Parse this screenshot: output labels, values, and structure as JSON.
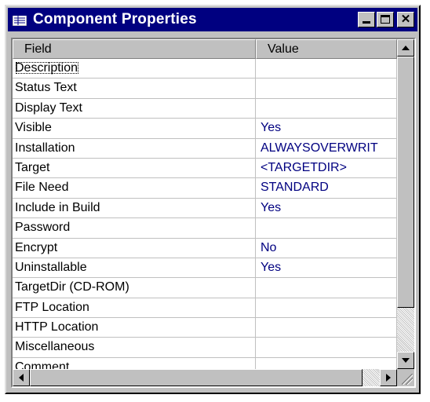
{
  "window": {
    "title": "Component Properties"
  },
  "icons": {
    "title": "properties-window-icon",
    "minimize": "minimize-icon",
    "maximize": "maximize-icon",
    "close": "close-icon",
    "close_glyph": "✕"
  },
  "grid": {
    "columns": [
      "Field",
      "Value"
    ],
    "rows": [
      {
        "field": "Description",
        "value": ""
      },
      {
        "field": "Status Text",
        "value": ""
      },
      {
        "field": "Display Text",
        "value": ""
      },
      {
        "field": "Visible",
        "value": "Yes"
      },
      {
        "field": "Installation",
        "value": "ALWAYSOVERWRIT"
      },
      {
        "field": "Target",
        "value": "<TARGETDIR>"
      },
      {
        "field": "File Need",
        "value": "STANDARD"
      },
      {
        "field": "Include in Build",
        "value": "Yes"
      },
      {
        "field": "Password",
        "value": ""
      },
      {
        "field": "Encrypt",
        "value": "No"
      },
      {
        "field": "Uninstallable",
        "value": "Yes"
      },
      {
        "field": "TargetDir (CD-ROM)",
        "value": ""
      },
      {
        "field": "FTP Location",
        "value": ""
      },
      {
        "field": "HTTP Location",
        "value": ""
      },
      {
        "field": "Miscellaneous",
        "value": ""
      },
      {
        "field": "Comment",
        "value": ""
      }
    ]
  },
  "colors": {
    "titlebar": "#000080",
    "value_text": "#000080",
    "face": "#c0c0c0"
  }
}
